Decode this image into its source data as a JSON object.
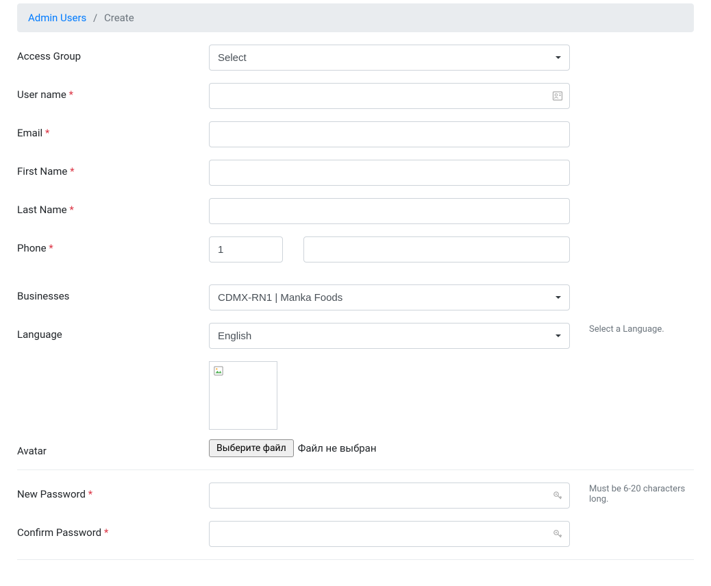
{
  "breadcrumb": {
    "parent": "Admin Users",
    "current": "Create"
  },
  "labels": {
    "access_group": "Access Group",
    "user_name": "User name",
    "email": "Email",
    "first_name": "First Name",
    "last_name": "Last Name",
    "phone": "Phone",
    "businesses": "Businesses",
    "language": "Language",
    "avatar": "Avatar",
    "new_password": "New Password",
    "confirm_password": "Confirm Password"
  },
  "required_mark": "*",
  "values": {
    "access_group": "Select",
    "phone_code": "1",
    "businesses": "CDMX-RN1 | Manka Foods",
    "language": "English"
  },
  "help": {
    "language": "Select a Language.",
    "password": "Must be 6-20 characters long."
  },
  "file": {
    "button": "Выберите файл",
    "status": "Файл не выбран"
  }
}
